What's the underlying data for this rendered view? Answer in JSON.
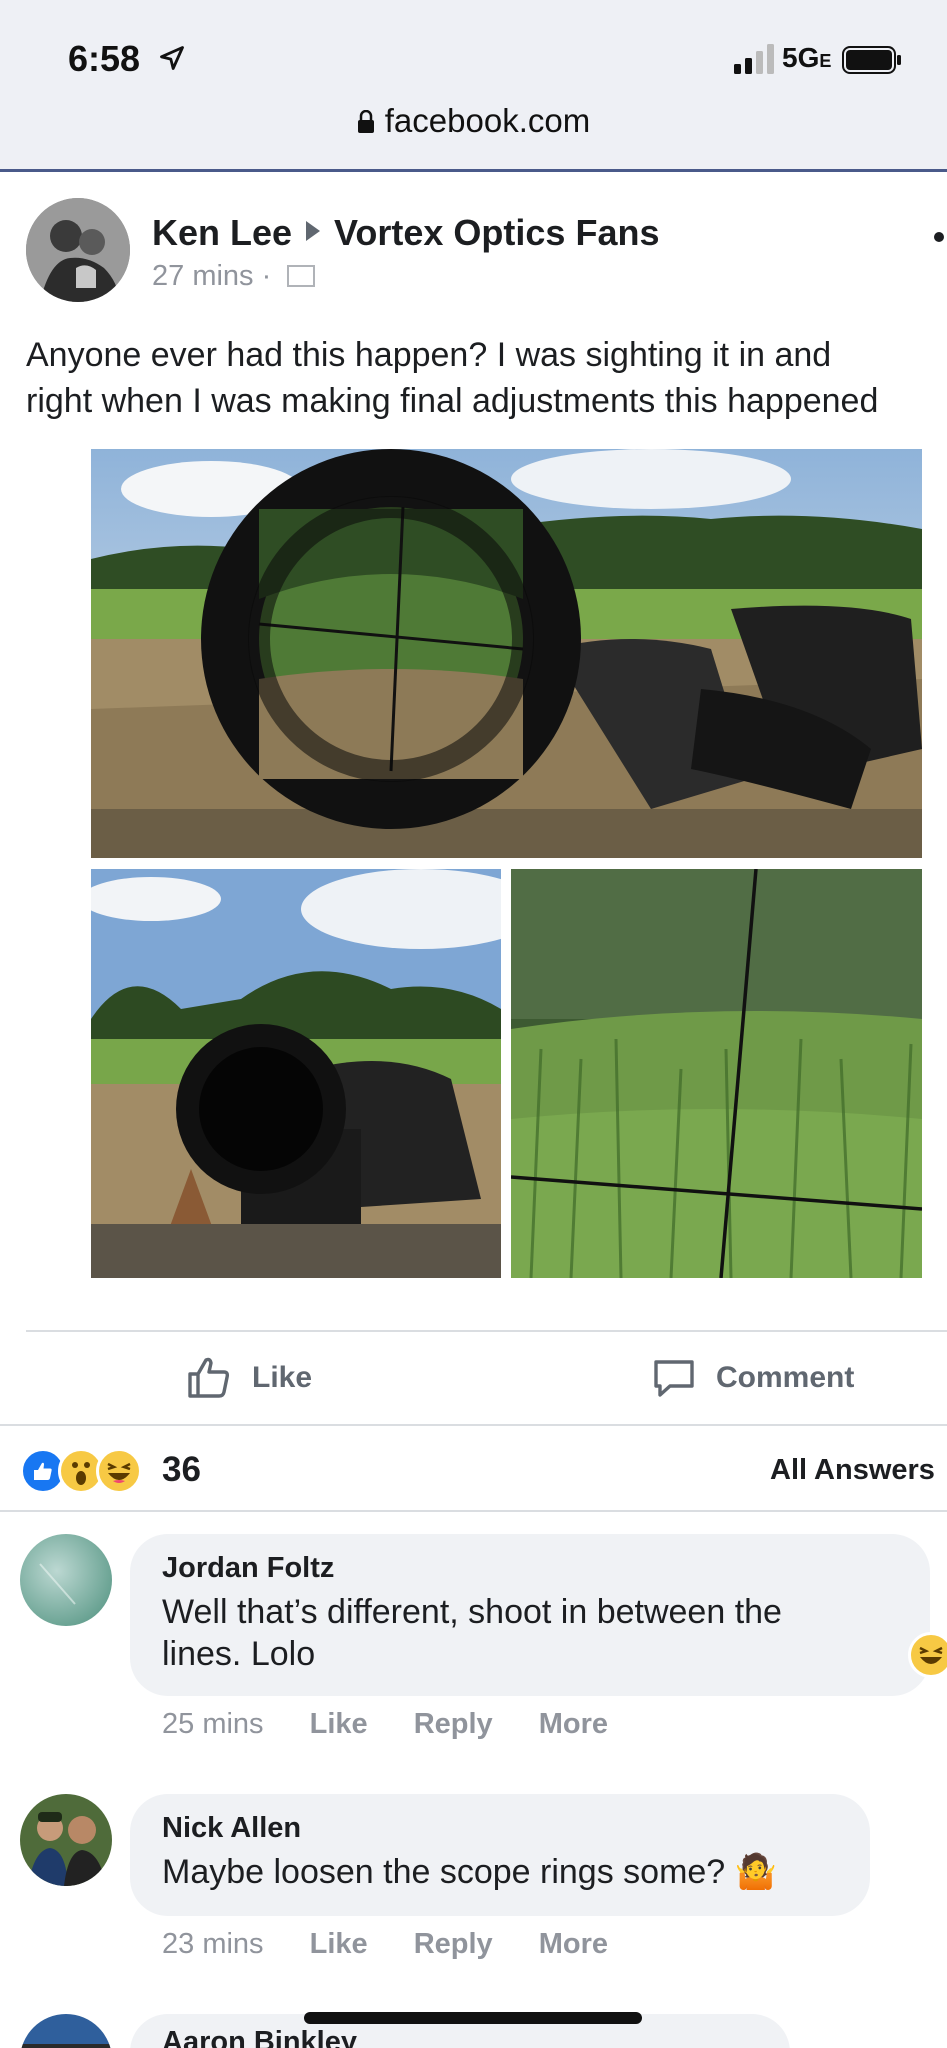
{
  "status_bar": {
    "time": "6:58",
    "network": "5G",
    "network_suffix": "E"
  },
  "browser": {
    "url": "facebook.com"
  },
  "post": {
    "author": "Ken Lee",
    "group": "Vortex Optics Fans",
    "timestamp": "27 mins",
    "separator": "·",
    "text_line1": "Anyone ever had this happen? I was sighting it in and",
    "text_line2": "right when I was making final adjustments this happened",
    "photos": [
      "scope-eyepiece-photo",
      "scope-rifle-photo",
      "crosshair-view-photo"
    ]
  },
  "actions": {
    "like_label": "Like",
    "comment_label": "Comment"
  },
  "reactions": {
    "types": [
      "like",
      "wow",
      "haha"
    ],
    "count": "36",
    "all_answers": "All Answers"
  },
  "comments": [
    {
      "name": "Jordan Foltz",
      "text_line1": "Well that’s different, shoot in between the",
      "text_line2": "lines. Lolo",
      "time": "25 mins",
      "like": "Like",
      "reply": "Reply",
      "more": "More"
    },
    {
      "name": "Nick Allen",
      "text": "Maybe loosen the scope rings some? 🤷",
      "time": "23 mins",
      "like": "Like",
      "reply": "Reply",
      "more": "More"
    },
    {
      "name": "Aaron Binkley"
    }
  ],
  "colors": {
    "brand_blue": "#1877f2",
    "text": "#1c1e21",
    "muted": "#90949c",
    "bubble": "#f0f2f5"
  }
}
